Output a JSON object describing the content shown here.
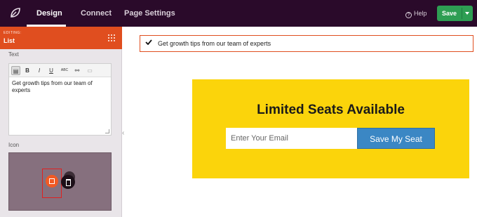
{
  "topbar": {
    "tabs": [
      {
        "label": "Design",
        "active": true
      },
      {
        "label": "Connect",
        "active": false
      },
      {
        "label": "Page Settings",
        "active": false
      }
    ],
    "help_label": "Help",
    "save_label": "Save"
  },
  "panel": {
    "kicker": "EDITING:",
    "title": "List",
    "text_label": "Text",
    "editor": {
      "toolbar": [
        "paste",
        "B",
        "I",
        "U",
        "ABC",
        "link",
        "image"
      ],
      "content": "Get growth tips from our team of experts"
    },
    "icon_label": "Icon"
  },
  "canvas": {
    "list_item_text": "Get growth tips from our team of experts",
    "promo": {
      "title": "Limited Seats Available",
      "email_placeholder": "Enter Your Email",
      "button_label": "Save My Seat"
    }
  },
  "colors": {
    "topbar": "#2a0a2a",
    "accent": "#e04e1f",
    "save": "#2e9e53",
    "promo_bg": "#fbd40b",
    "button": "#3b87c4"
  }
}
